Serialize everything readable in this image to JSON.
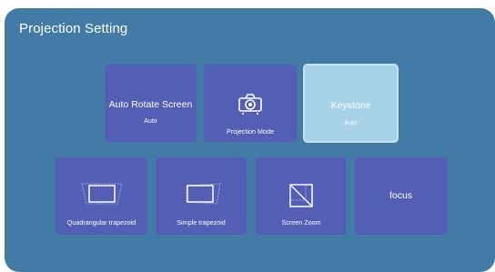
{
  "page": {
    "title": "Projection Setting"
  },
  "row1": [
    {
      "title": "Auto Rotate Screen",
      "value": "Auto"
    },
    {
      "label": "Projection Mode",
      "icon": "projector-icon"
    },
    {
      "title": "Keystone",
      "value": "Auto",
      "selected": true
    }
  ],
  "row2": [
    {
      "label": "Quadrangular trapezoid",
      "icon": "quadrangular-trapezoid-icon"
    },
    {
      "label": "Simple trapezoid",
      "icon": "simple-trapezoid-icon"
    },
    {
      "label": "Screen Zoom",
      "icon": "screen-zoom-icon"
    },
    {
      "title": "focus"
    }
  ],
  "colors": {
    "panel": "#427ba5",
    "tile": "#525fb4",
    "tile_selected": "#a8d2e8",
    "text": "#ffffff"
  }
}
